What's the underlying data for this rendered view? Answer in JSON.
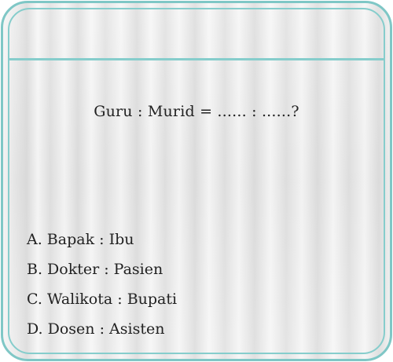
{
  "question": {
    "text": "Guru : Murid = ...... : ......?"
  },
  "options": [
    {
      "letter": "A.",
      "text": "A. Bapak : Ibu"
    },
    {
      "letter": "B.",
      "text": "B. Dokter : Pasien"
    },
    {
      "letter": "C.",
      "text": "C. Walikota : Bupati"
    },
    {
      "letter": "D.",
      "text": "D. Dosen : Asisten"
    }
  ],
  "colors": {
    "frame": "#7fc7c6",
    "text": "#222222",
    "background": "#e6e6e6"
  }
}
